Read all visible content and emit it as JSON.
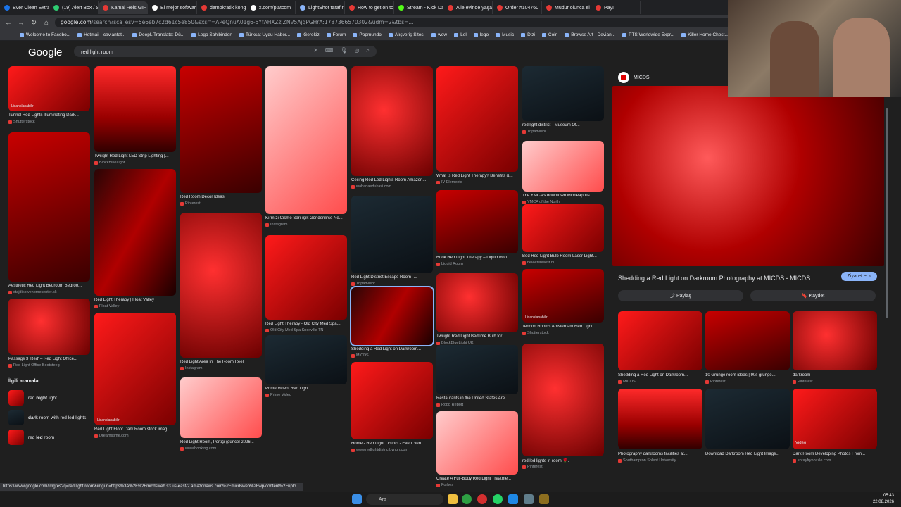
{
  "tabs": [
    {
      "label": "Ever Clean Extra",
      "color": "#1a73e8"
    },
    {
      "label": "(19) Alert Box / S",
      "color": "#2ecc71"
    },
    {
      "label": "Kamal Reis GIF -",
      "color": "#e53935"
    },
    {
      "label": "El mejor software",
      "color": "#ffffff"
    },
    {
      "label": "demokratik kong",
      "color": "#e53935"
    },
    {
      "label": "x.com/platcom",
      "color": "#ffffff"
    },
    {
      "label": "LightShot tarafın",
      "color": "#8ab4f8"
    },
    {
      "label": "How to get on to",
      "color": "#e53935"
    },
    {
      "label": "Stream - Kick Das",
      "color": "#53fc18"
    },
    {
      "label": "Aile evinde yaşay",
      "color": "#e53935"
    },
    {
      "label": "Order #104760",
      "color": "#e53935"
    },
    {
      "label": "Müdür olunca el",
      "color": "#e53935"
    },
    {
      "label": "Payı",
      "color": "#e53935"
    }
  ],
  "address": {
    "domain": "google.com",
    "path": "/search?sca_esv=5e6eb7c2d61c5e850&sxsrf=APeQnuA01g6-5YfAHXZzjZNV5AjqPGHrA:1787366570302&udm=2&tbs=..."
  },
  "bookmarks": [
    "Welcome to Facebo...",
    "Hotmail - cavlantat...",
    "DeepL Translate: Dü...",
    "Lego Sahibinden",
    "Türksat Uydu Haber...",
    "Gerekiz",
    "Forum",
    "Popmundo",
    "Alışveriş Sitesi",
    "wow",
    "Lol",
    "lego",
    "Music",
    "Dizi",
    "Coin",
    "Browse Art - Devian...",
    "PTS Worldwide Expr...",
    "Killer Home Chest..."
  ],
  "google": {
    "logo": "Google",
    "query": "red light room"
  },
  "columns": [
    [
      {
        "cap": "Tunnel Red Lights Illuminating Dark...",
        "src": "Shutterstock",
        "badge": "Lisanslanabilir"
      },
      {
        "cap": "Aesthetic Red Light Bedroom Bedroo...",
        "src": "stajdikoivehomecenter.sk"
      },
      {
        "cap": "Passage 3 'Red' – Red Light Office...",
        "src": "Red Light Office Bootsteeg"
      }
    ],
    [
      {
        "cap": "Twilight Red Light LED Strip Lighting |...",
        "src": "BlockBlueLight"
      },
      {
        "cap": "Red Light Therapy | Float Valley",
        "src": "Float Valley"
      },
      {
        "cap": "Red Light Floor Dark Room stock imag...",
        "src": "Dreamstime.com",
        "badge": "Lisanslanabilir"
      }
    ],
    [
      {
        "cap": "Red Room Decor Ideas",
        "src": "Pinterest"
      },
      {
        "cap": "Red Light Area In The Room Reel",
        "src": "Instagram"
      },
      {
        "cap": "Red Light Room, Portiçi (güncel 2026...",
        "src": "www.booking.com"
      }
    ],
    [
      {
        "cap": "Kırmızı Cisme Sarı ışık Gönderilirse Ne...",
        "src": "Instagram"
      },
      {
        "cap": "Red Light Therapy - Old City Med Spa...",
        "src": "Old City Med Spa Knoxville TN"
      },
      {
        "cap": "Prime Video: Red Light",
        "src": "Prime Video"
      }
    ],
    [
      {
        "cap": "Ceiling Red Led Lights Room Amazon...",
        "src": "wahanaedukasi.com"
      },
      {
        "cap": "Red Light District Escape Room -...",
        "src": "Tripadvisor"
      },
      {
        "cap": "Shedding a Red Light on Darkroom...",
        "src": "MICDS"
      },
      {
        "cap": "Home - Red Light District - Event ven...",
        "src": "www.redlightdistrictbyngn.com"
      }
    ],
    [
      {
        "cap": "What Is Red Light Therapy? Benefits &...",
        "src": "IV Elements"
      },
      {
        "cap": "Book Red Light Therapy – Liquid Roo...",
        "src": "Liquid Room"
      },
      {
        "cap": "Twilight Red Light Bedtime Bulb for...",
        "src": "BlockBlueLight UK"
      },
      {
        "cap": "Restaurants in the United States Are...",
        "src": "Robb Report"
      },
      {
        "cap": "Create A Full-Body Red Light Treatme...",
        "src": "Forbes"
      }
    ],
    [
      {
        "cap": "red light district - Museum Of...",
        "src": "Tripadvisor"
      },
      {
        "cap": "The YMCA's downtown Minneapolis...",
        "src": "YMCA of the North"
      },
      {
        "cap": "Bed Red Light Bulb Room Laser Light...",
        "src": "beleefenwest.nl"
      },
      {
        "cap": "Tendon Rooms Amsterdam Red Light...",
        "src": "Shutterstock",
        "badge": "Lisanslanabilir"
      },
      {
        "cap": "red led lights in room 🌹.",
        "src": "Pinterest"
      }
    ]
  ],
  "related": {
    "title": "İlgili aramalar",
    "items": [
      {
        "pre": "red ",
        "bold": "night",
        "post": " light"
      },
      {
        "pre": "",
        "bold": "dark",
        "post": " room with red led lights"
      },
      {
        "pre": "red ",
        "bold": "led",
        "post": " room"
      }
    ]
  },
  "panel": {
    "source": "MICDS",
    "title": "Shedding a Red Light on Darkroom Photography at MICDS - MICDS",
    "visit": "Ziyaret et",
    "share": "Paylaş",
    "save": "Kaydet",
    "thumbs": [
      {
        "cap": "Shedding a Red Light on Darkroom...",
        "src": "MICDS"
      },
      {
        "cap": "10 Grunge room ideas | 90s grunge...",
        "src": "Pinterest"
      },
      {
        "cap": "darkroom",
        "src": "Pinterest"
      },
      {
        "cap": "Photography darkrooms facilities at...",
        "src": "Southampton Solent University"
      },
      {
        "cap": "Download Darkroom Red Light Image...",
        "src": ""
      },
      {
        "cap": "Dark Room Developing Photos From...",
        "src": "sprayfrynozzle.com"
      }
    ],
    "video_badge": "Video"
  },
  "status_url": "https://www.google.com/imgres?q=red light room&imgurl=https%3A%2F%2Fmicdsweb.s3.us-east-2.amazonaws.com%2Fmicdsweb%2Fwp-content%2Fuplo...",
  "taskbar": {
    "search": "Ara",
    "time": "05:43",
    "date": "22.08.2026"
  }
}
